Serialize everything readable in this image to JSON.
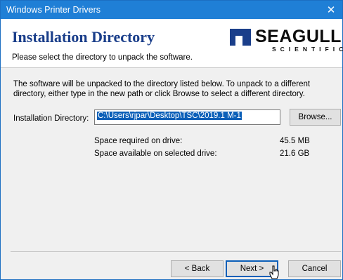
{
  "window": {
    "title": "Windows Printer Drivers",
    "close_glyph": "✕"
  },
  "header": {
    "heading": "Installation Directory",
    "subheading": "Please select the directory to unpack the software.",
    "logo": {
      "brand": "SEAGULL",
      "brand_sub": "SCIENTIFIC",
      "icon": "seagull-logo-mark"
    }
  },
  "main": {
    "description": "The software will be unpacked to the directory listed below.  To unpack to a different directory, either type in the new path or click Browse to select a different directory.",
    "directory_label": "Installation Directory:",
    "directory_value": "C:\\Users\\rjpar\\Desktop\\TSC\\2019.1 M-1",
    "browse_label": "Browse...",
    "space_required_label": "Space required on drive:",
    "space_required_value": "45.5 MB",
    "space_available_label": "Space available on selected drive:",
    "space_available_value": "21.6 GB"
  },
  "footer": {
    "back_label": "< Back",
    "next_label": "Next >",
    "cancel_label": "Cancel"
  },
  "colors": {
    "titlebar": "#1f7fd6",
    "heading": "#1a3e8a",
    "selection": "#0b5fb8"
  }
}
